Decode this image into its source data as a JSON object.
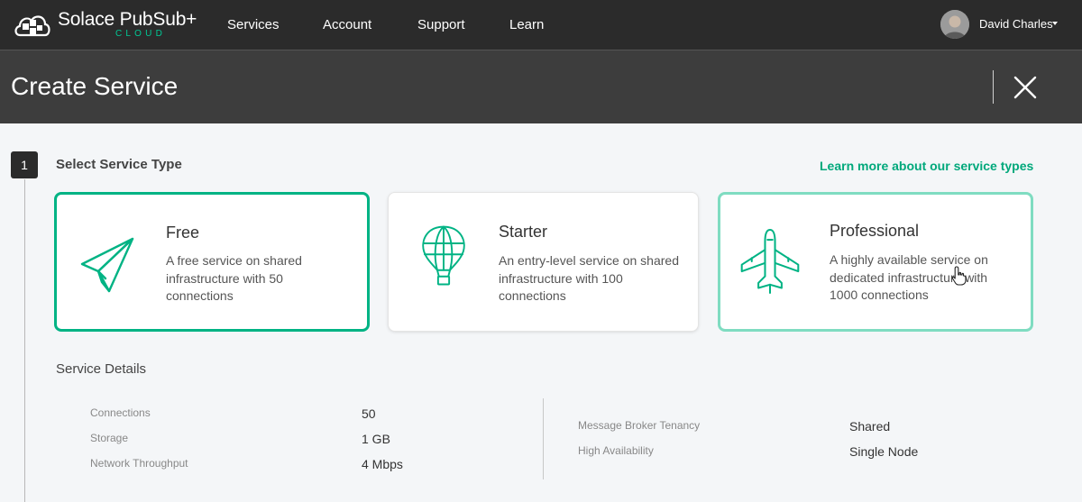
{
  "app": {
    "logo_name": "Solace PubSub+",
    "logo_sub": "CLOUD",
    "nav": [
      "Services",
      "Account",
      "Support",
      "Learn"
    ],
    "user_name": "David Charles"
  },
  "header": {
    "title": "Create Service",
    "close_icon": "close-icon"
  },
  "step": {
    "number": "1",
    "title": "Select Service Type",
    "learn_link": "Learn more about our service types"
  },
  "service_types": [
    {
      "title": "Free",
      "description": "A free service on shared infrastructure with 50 connections",
      "icon": "paper-plane-icon",
      "selected": true
    },
    {
      "title": "Starter",
      "description": "An entry-level service on shared infrastructure with 100 connections",
      "icon": "hot-air-balloon-icon",
      "selected": false
    },
    {
      "title": "Professional",
      "description": "A highly available service on dedicated infrastructure with 1000 connections",
      "icon": "airplane-icon",
      "selected": false
    }
  ],
  "service_details": {
    "title": "Service Details",
    "left": [
      {
        "label": "Connections",
        "value": "50"
      },
      {
        "label": "Storage",
        "value": "1 GB"
      },
      {
        "label": "Network Throughput",
        "value": "4 Mbps"
      }
    ],
    "right": [
      {
        "label": "Message Broker Tenancy",
        "value": "Shared"
      },
      {
        "label": "High Availability",
        "value": "Single Node"
      }
    ]
  },
  "colors": {
    "accent": "#00b384",
    "accent_light": "#7fdcc1",
    "nav_bg": "#2b2b2b",
    "header_bg": "#3d3d3d",
    "page_bg": "#f4f6f8"
  }
}
